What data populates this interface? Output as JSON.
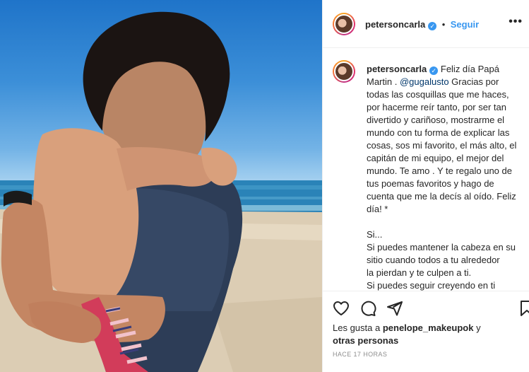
{
  "post": {
    "username": "petersoncarla",
    "follow_label": "Seguir",
    "more_label": "•••",
    "verified_mark": "✓"
  },
  "caption": {
    "username": "petersoncarla",
    "text_before": " Feliz día Papá Martin . ",
    "mention": "@gugalusto",
    "text_after": " Gracias por todas las cosquillas que me haces, por hacerme reír tanto, por ser tan divertido y cariñoso, mostrarme el mundo con tu forma de explicar las cosas, sos mi favorito, el más alto, el capitán de mi equipo, el mejor del mundo. Te amo . Y te regalo uno de tus poemas favoritos y hago de cuenta que me la decís al oído. Feliz día! *\n\nSi...\nSi puedes mantener la cabeza en su sitio cuando todos a tu alrededor\nla pierdan y te culpen a ti.\nSi puedes seguir creyendo en ti mismo cuando todos dudan de ti,\npero también aceptas que tengan"
  },
  "engagement": {
    "likes_prefix": "Les gusta a",
    "likes_user": "penelope_makeupok",
    "likes_suffix": "y",
    "likes_others": "otras personas",
    "timestamp": "HACE 17 HORAS"
  },
  "icons": [
    "heart-icon",
    "comment-icon",
    "share-icon",
    "bookmark-icon"
  ],
  "colors": {
    "link_blue": "#3897f0",
    "mention_blue": "#00376b",
    "muted_gray": "#8e8e8e"
  }
}
